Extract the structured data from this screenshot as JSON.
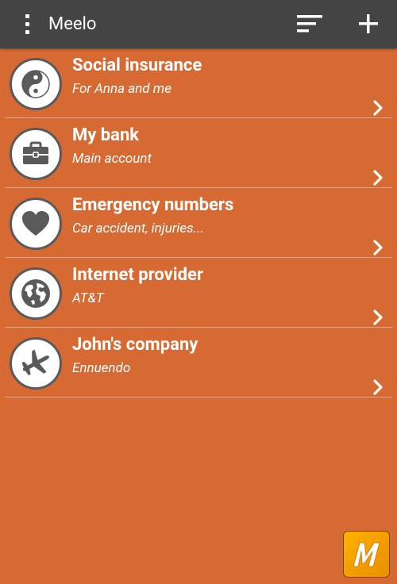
{
  "app": {
    "title": "Meelo"
  },
  "icons": {
    "menu": "overflow-menu-icon",
    "sort": "sort-icon",
    "add": "plus-icon",
    "logo": "meelo-logo"
  },
  "colors": {
    "background": "#d66a32",
    "appbar": "#444444",
    "icon_gray": "#5a5a5a"
  },
  "items": [
    {
      "title": "Social insurance",
      "subtitle": "For Anna and me",
      "icon": "yin-yang-icon"
    },
    {
      "title": "My bank",
      "subtitle": "Main account",
      "icon": "briefcase-icon"
    },
    {
      "title": "Emergency numbers",
      "subtitle": "Car accident, injuries...",
      "icon": "heart-icon"
    },
    {
      "title": "Internet provider",
      "subtitle": "AT&T",
      "icon": "globe-icon"
    },
    {
      "title": "John's company",
      "subtitle": "Ennuendo",
      "icon": "airplane-icon"
    }
  ]
}
